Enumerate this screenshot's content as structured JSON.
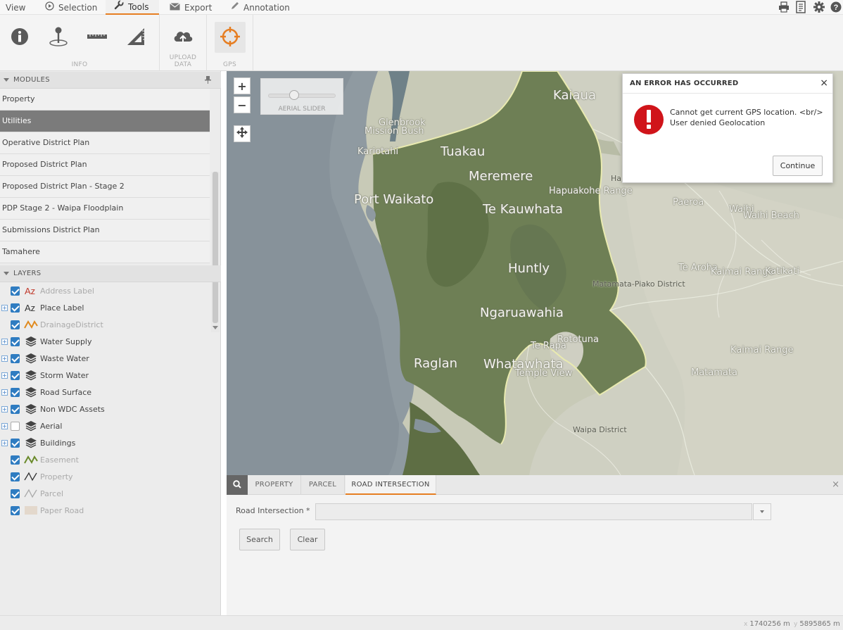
{
  "menubar": {
    "tabs": [
      {
        "label": "View",
        "icon": "none"
      },
      {
        "label": "Selection",
        "icon": "selection-icon"
      },
      {
        "label": "Tools",
        "icon": "wrench-icon",
        "active": true
      },
      {
        "label": "Export",
        "icon": "envelope-icon"
      },
      {
        "label": "Annotation",
        "icon": "pencil-icon"
      }
    ],
    "right_icons": [
      "print-icon",
      "document-icon",
      "gear-icon",
      "help-icon"
    ]
  },
  "ribbon": {
    "groups": [
      {
        "caption": "INFO",
        "buttons": [
          "info-icon",
          "identify-pin-icon",
          "measure-ruler-icon",
          "set-square-icon"
        ]
      },
      {
        "caption": "UPLOAD DATA",
        "buttons": [
          "cloud-upload-icon"
        ]
      },
      {
        "caption": "GPS",
        "buttons": [
          "gps-crosshair-icon"
        ]
      }
    ]
  },
  "modules": {
    "header": "MODULES",
    "items": [
      "Property",
      "Utilities",
      "Operative District Plan",
      "Proposed District Plan",
      "Proposed District Plan - Stage 2",
      "PDP Stage 2 - Waipa Floodplain",
      "Submissions District Plan",
      "Tamahere"
    ],
    "selected": "Utilities"
  },
  "layers": {
    "header": "LAYERS",
    "items": [
      {
        "name": "Address Label",
        "checked": true,
        "expandable": false,
        "icon": "text-label-red-icon",
        "dim": true
      },
      {
        "name": "Place Label",
        "checked": true,
        "expandable": true,
        "icon": "text-label-dark-icon",
        "dim": false
      },
      {
        "name": "DrainageDistrict",
        "checked": true,
        "expandable": false,
        "icon": "line-orange-icon",
        "dim": true
      },
      {
        "name": "Water Supply",
        "checked": true,
        "expandable": true,
        "icon": "layers-stack-icon",
        "dim": false
      },
      {
        "name": "Waste Water",
        "checked": true,
        "expandable": true,
        "icon": "layers-stack-icon",
        "dim": false
      },
      {
        "name": "Storm Water",
        "checked": true,
        "expandable": true,
        "icon": "layers-stack-icon",
        "dim": false
      },
      {
        "name": "Road Surface",
        "checked": true,
        "expandable": true,
        "icon": "layers-stack-icon",
        "dim": false
      },
      {
        "name": "Non WDC Assets",
        "checked": true,
        "expandable": true,
        "icon": "layers-stack-icon",
        "dim": false
      },
      {
        "name": "Aerial",
        "checked": false,
        "expandable": true,
        "icon": "layers-stack-icon",
        "dim": false
      },
      {
        "name": "Buildings",
        "checked": true,
        "expandable": true,
        "icon": "layers-stack-icon",
        "dim": false
      },
      {
        "name": "Easement",
        "checked": true,
        "expandable": false,
        "icon": "line-green-icon",
        "dim": true
      },
      {
        "name": "Property",
        "checked": true,
        "expandable": false,
        "icon": "line-dark-icon",
        "dim": true
      },
      {
        "name": "Parcel",
        "checked": true,
        "expandable": false,
        "icon": "line-grey-icon",
        "dim": true
      },
      {
        "name": "Paper Road",
        "checked": true,
        "expandable": false,
        "icon": "swatch-tan-icon",
        "dim": true
      }
    ]
  },
  "map": {
    "controls": {
      "zoom_in": "+",
      "zoom_out": "−",
      "pan": "pan-arrows-icon"
    },
    "slider_caption": "AERIAL SLIDER",
    "labels": [
      {
        "text": "Kaiaua",
        "size": "large"
      },
      {
        "text": "Glenbrook",
        "size": "medium"
      },
      {
        "text": "Mission Bush",
        "size": "medium"
      },
      {
        "text": "Kariotahi",
        "size": "medium"
      },
      {
        "text": "Tuakau",
        "size": "large"
      },
      {
        "text": "Meremere",
        "size": "large"
      },
      {
        "text": "Ha",
        "size": "small"
      },
      {
        "text": "Hapuakohe Range",
        "size": "medium"
      },
      {
        "text": "Port Waikato",
        "size": "large"
      },
      {
        "text": "Te Kauwhata",
        "size": "large"
      },
      {
        "text": "Paeroa",
        "size": "medium"
      },
      {
        "text": "Waihi",
        "size": "medium"
      },
      {
        "text": "Waihi Beach",
        "size": "medium"
      },
      {
        "text": "Huntly",
        "size": "large"
      },
      {
        "text": "Te Aroha",
        "size": "medium"
      },
      {
        "text": "Kaimai Range",
        "size": "medium"
      },
      {
        "text": "Katikati",
        "size": "medium"
      },
      {
        "text": "Matamata-Piako District",
        "size": "small"
      },
      {
        "text": "Ngaruawahia",
        "size": "large"
      },
      {
        "text": "Rototuna",
        "size": "medium"
      },
      {
        "text": "Te Rapa",
        "size": "medium"
      },
      {
        "text": "Kaimai Range",
        "size": "medium"
      },
      {
        "text": "Raglan",
        "size": "large"
      },
      {
        "text": "Whatawhata",
        "size": "large"
      },
      {
        "text": "Temple View",
        "size": "medium"
      },
      {
        "text": "Matamata",
        "size": "medium"
      },
      {
        "text": "Waipa District",
        "size": "small"
      }
    ]
  },
  "dialog": {
    "title": "AN ERROR HAS OCCURRED",
    "message_line1": "Cannot get current GPS location. <br/>",
    "message_line2": "User denied Geolocation",
    "button": "Continue",
    "close": "×"
  },
  "bottom_panel": {
    "tabs": [
      "PROPERTY",
      "PARCEL",
      "ROAD INTERSECTION"
    ],
    "active_tab": "ROAD INTERSECTION",
    "field_label": "Road Intersection *",
    "field_value": "",
    "search_button": "Search",
    "clear_button": "Clear",
    "close": "×"
  },
  "status": {
    "x_axis": "x",
    "x_value": "1740256 m",
    "y_axis": "y",
    "y_value": "5895865 m"
  },
  "colors": {
    "accent": "#e67e22",
    "selected_module": "#7b7b7b",
    "checkbox": "#2f7cc1",
    "error": "#d0141a"
  }
}
